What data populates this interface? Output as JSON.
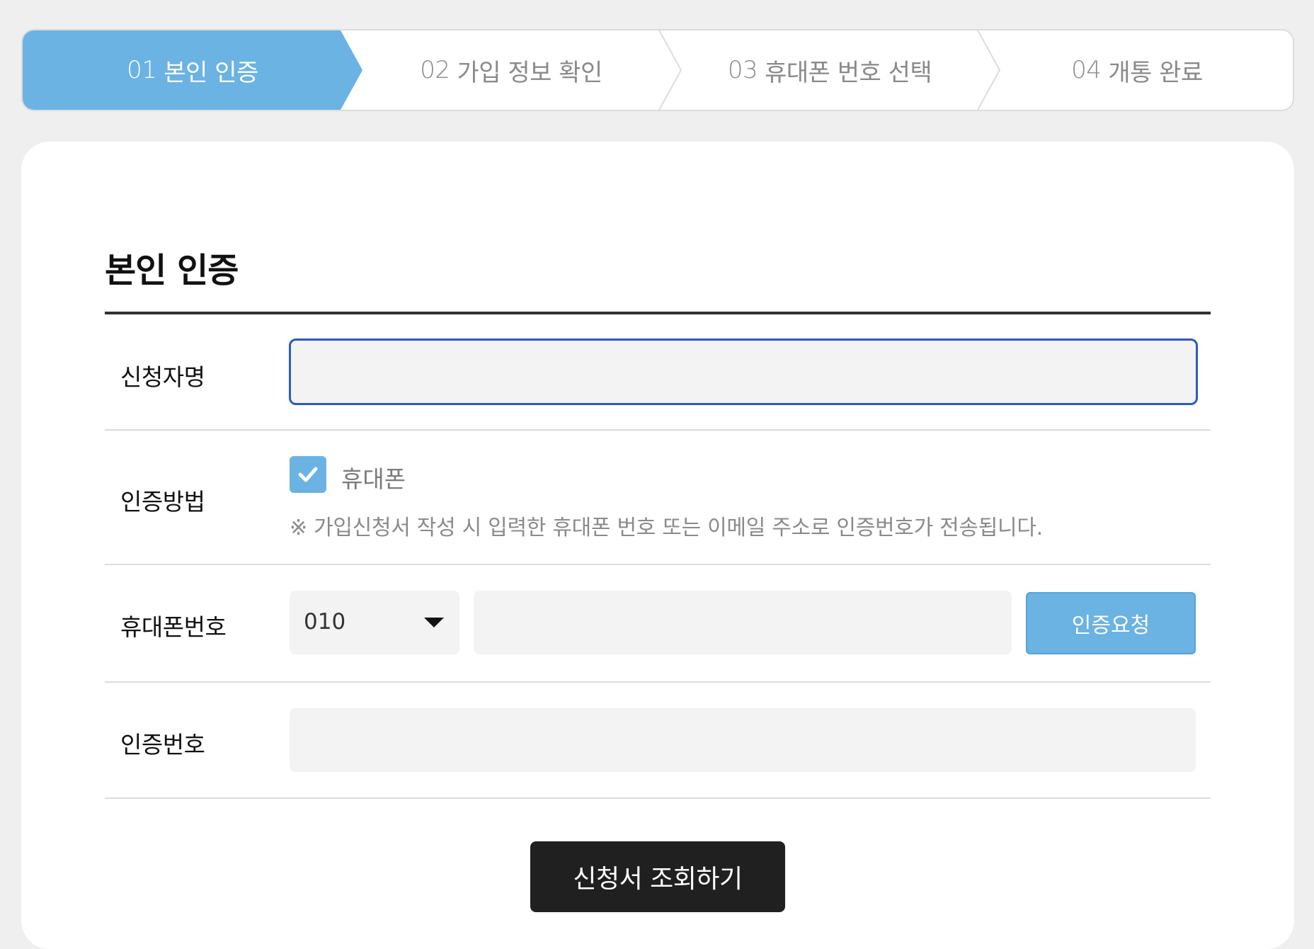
{
  "stepper": {
    "steps": [
      {
        "num": "01",
        "label": "본인 인증",
        "active": true
      },
      {
        "num": "02",
        "label": "가입 정보 확인",
        "active": false
      },
      {
        "num": "03",
        "label": "휴대폰 번호 선택",
        "active": false
      },
      {
        "num": "04",
        "label": "개통 완료",
        "active": false
      }
    ]
  },
  "form": {
    "title": "본인 인증",
    "applicant_label": "신청자명",
    "applicant_value": "",
    "method_label": "인증방법",
    "method_option": "휴대폰",
    "method_checked": true,
    "method_note": "※ 가입신청서 작성 시 입력한 휴대폰 번호 또는 이메일 주소로 인증번호가 전송됩니다.",
    "phone_label": "휴대폰번호",
    "phone_prefix": "010",
    "phone_value": "",
    "request_button": "인증요청",
    "code_label": "인증번호",
    "code_value": "",
    "submit_button": "신청서 조회하기"
  },
  "colors": {
    "accent": "#6ab3e3",
    "focus_border": "#2a5bbd",
    "submit_bg": "#202020"
  }
}
